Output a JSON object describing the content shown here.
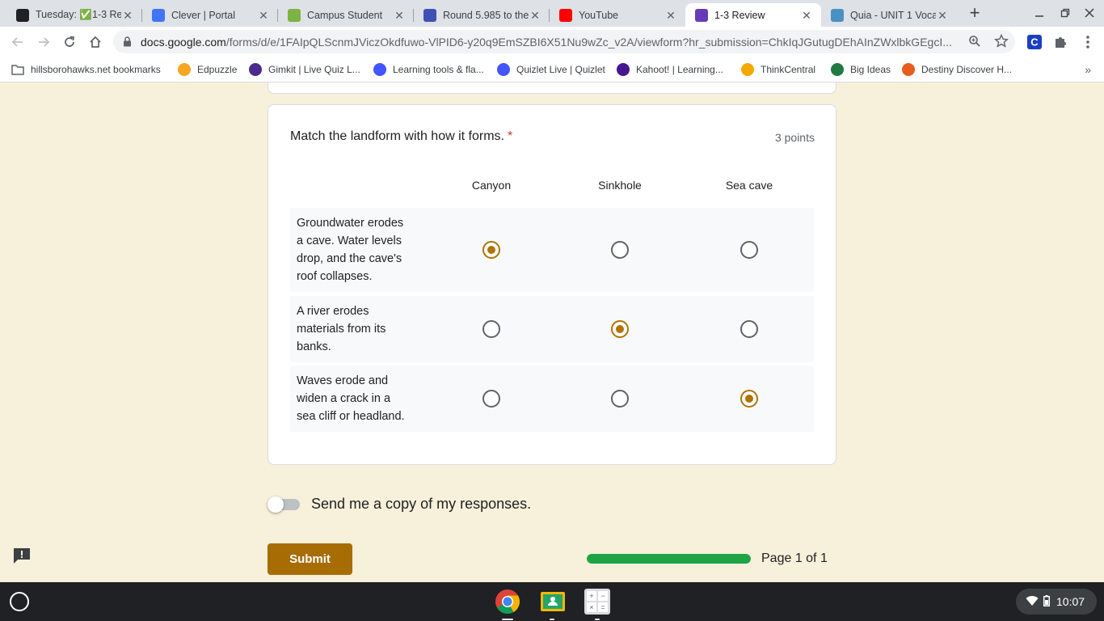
{
  "browser": {
    "tabs": [
      {
        "title": "Tuesday: ✅1-3 Re",
        "favicon": "classroom-icon",
        "color": "#202124"
      },
      {
        "title": "Clever | Portal",
        "favicon": "clever-icon",
        "color": "#4274f6"
      },
      {
        "title": "Campus Student",
        "favicon": "campus-icon",
        "color": "#7cb342"
      },
      {
        "title": "Round 5.985 to the",
        "favicon": "calculator-icon",
        "color": "#3f51b5"
      },
      {
        "title": "YouTube",
        "favicon": "youtube-icon",
        "color": "#ff0000"
      },
      {
        "title": "1-3 Review",
        "favicon": "google-forms-icon",
        "color": "#673ab7"
      },
      {
        "title": "Quia - UNIT 1 Voca",
        "favicon": "quia-icon",
        "color": "#4a90c2"
      }
    ],
    "active_tab_index": 5,
    "url_host": "docs.google.com",
    "url_path": "/forms/d/e/1FAIpQLScnmJViczOkdfuwo-VlPID6-y20q9EmSZBI6X51Nu9wZc_v2A/viewform?hr_submission=ChkIqJGutugDEhAInZWxlbkGEgcI..."
  },
  "bookmarks": [
    {
      "label": "hillsborohawks.net bookmarks",
      "icon": "folder-icon"
    },
    {
      "label": "Edpuzzle",
      "icon": "edpuzzle-icon"
    },
    {
      "label": "Gimkit | Live Quiz L...",
      "icon": "gimkit-icon"
    },
    {
      "label": "Learning tools & fla...",
      "icon": "quizlet-icon"
    },
    {
      "label": "Quizlet Live | Quizlet",
      "icon": "quizlet-icon"
    },
    {
      "label": "Kahoot! | Learning...",
      "icon": "kahoot-icon"
    },
    {
      "label": "ThinkCentral",
      "icon": "thinkcentral-icon"
    },
    {
      "label": "Big Ideas",
      "icon": "big-ideas-icon"
    },
    {
      "label": "Destiny Discover H...",
      "icon": "destiny-icon"
    }
  ],
  "form": {
    "question": "Match the landform with how it forms.",
    "required_mark": "*",
    "points": "3 points",
    "columns": [
      "Canyon",
      "Sinkhole",
      "Sea cave"
    ],
    "rows": [
      {
        "lines": [
          "Groundwater erodes",
          "a cave. Water levels",
          "drop, and the cave's",
          "roof collapses."
        ],
        "selected": "Canyon"
      },
      {
        "lines": [
          "A river erodes",
          "materials from its",
          "banks."
        ],
        "selected": "Sinkhole"
      },
      {
        "lines": [
          "Waves erode and",
          "widen a crack in a",
          "sea cliff or headland."
        ],
        "selected": "Sea cave"
      }
    ],
    "copy_label": "Send me a copy of my responses.",
    "copy_enabled": false,
    "submit_label": "Submit",
    "progress_fraction": 1.0,
    "page_text": "Page 1 of 1",
    "accent_color": "#a86c05"
  },
  "system": {
    "time": "10:07"
  }
}
